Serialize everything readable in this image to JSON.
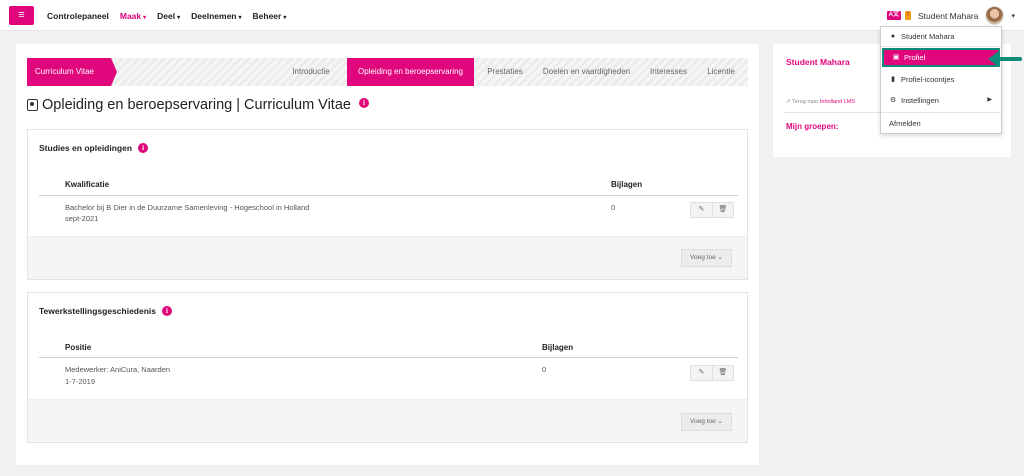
{
  "topbar": {
    "menu_icon": "hamburger-icon",
    "nav": [
      {
        "label": "Controlepaneel",
        "active": false,
        "dropdown": false
      },
      {
        "label": "Maak",
        "active": true,
        "dropdown": true
      },
      {
        "label": "Deel",
        "active": false,
        "dropdown": true
      },
      {
        "label": "Deelnemen",
        "active": false,
        "dropdown": true
      },
      {
        "label": "Beheer",
        "active": false,
        "dropdown": true
      }
    ],
    "lang_badge": "A文",
    "alert_badge": "!",
    "user_name": "Student Mahara",
    "caret": "▾"
  },
  "tabs": {
    "first": "Curriculum Vitae",
    "items": [
      "Introductie",
      "Opleiding en beroepservaring",
      "Prestaties",
      "Doelen en vaardigheden",
      "Interesses",
      "Licentie"
    ],
    "active_index": 1
  },
  "page": {
    "title": "Opleiding en beroepservaring | Curriculum Vitae",
    "info": "i"
  },
  "education": {
    "heading": "Studies en opleidingen",
    "columns": [
      "Kwalificatie",
      "Bijlagen"
    ],
    "rows": [
      {
        "title": "Bachelor bij B Dier in de Duurzame Samenleving - Hogeschool in Holland",
        "date": "sept-2021",
        "attachments": "0"
      }
    ],
    "add_label": "Voeg toe"
  },
  "employment": {
    "heading": "Tewerkstellingsgeschiedenis",
    "columns": [
      "Positie",
      "Bijlagen"
    ],
    "rows": [
      {
        "title": "Medewerker: AniCura, Naarden",
        "date": "1-7-2019",
        "attachments": "0"
      }
    ],
    "add_label": "Voeg toe"
  },
  "sidebar": {
    "name": "Student Mahara",
    "back_prefix": "Terug naar",
    "back_link": "Inholland LMS",
    "groups_label": "Mijn groepen:"
  },
  "dropdown": {
    "items": [
      {
        "label": "Student Mahara",
        "icon": "user-icon"
      },
      {
        "label": "Profiel",
        "icon": "id-card-icon",
        "active": true
      },
      {
        "label": "Profiel-icoontjes",
        "icon": "portrait-icon"
      },
      {
        "label": "Instellingen",
        "icon": "cogs-icon",
        "submenu": true
      },
      {
        "label": "Afmelden",
        "icon": ""
      }
    ]
  },
  "colors": {
    "accent": "#e0067c",
    "highlight_border": "#0e8c7a",
    "arrow": "#0e8c7a"
  }
}
